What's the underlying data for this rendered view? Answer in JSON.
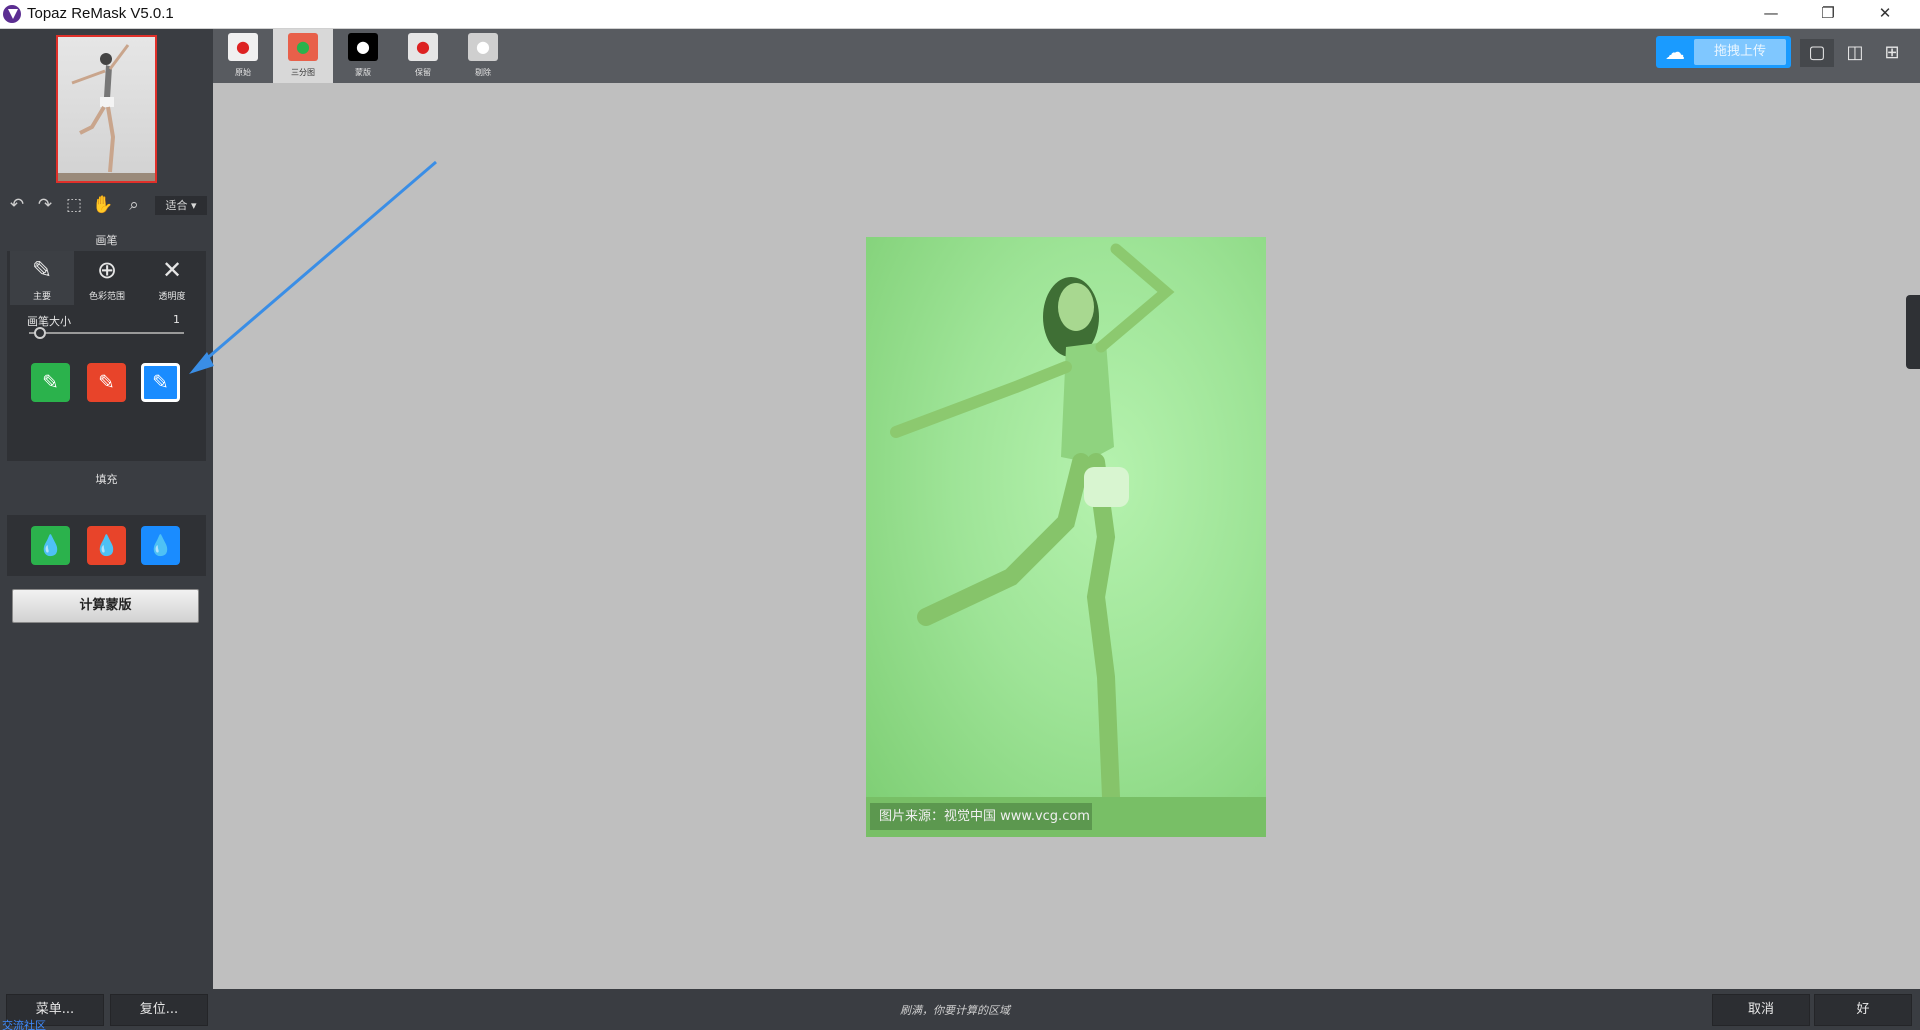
{
  "window": {
    "title": "Topaz ReMask V5.0.1",
    "minimize_glyph": "—",
    "restore_glyph": "❐",
    "close_glyph": "✕"
  },
  "left_panel": {
    "zoom_select": "适合 ▾",
    "brush_section_title": "画笔",
    "brush_types": [
      {
        "label": "主要",
        "icon": "brush-icon"
      },
      {
        "label": "色彩范围",
        "icon": "color-range-brush-icon"
      },
      {
        "label": "透明度",
        "icon": "transparency-brush-icon"
      }
    ],
    "brush_size_label": "画笔大小",
    "brush_size_value": "1",
    "brush_size_fraction": 0.03,
    "fill_section_title": "填充",
    "compute_button": "计算蒙版"
  },
  "toolbar": {
    "view_tabs": [
      {
        "label": "原始",
        "icon": "apple-icon"
      },
      {
        "label": "三分图",
        "icon": "trimap-icon"
      },
      {
        "label": "蒙版",
        "icon": "mask-icon"
      },
      {
        "label": "保留",
        "icon": "keep-icon"
      },
      {
        "label": "剔除",
        "icon": "cutout-icon"
      }
    ],
    "active_tab_index": 1,
    "upload_label": "拖拽上传"
  },
  "canvas": {
    "watermark": "图片来源：视觉中国 www.vcg.com"
  },
  "statusbar": {
    "menu_button": "菜单...",
    "reset_button": "复位...",
    "hint": "刷满，你要计算的区域",
    "cancel_button": "取消",
    "ok_button": "好",
    "community_link": "交流社区"
  },
  "colors": {
    "keep": "#2bb24c",
    "drop": "#e8442a",
    "compute": "#1a8cff",
    "annotation_arrow": "#3a8ee6"
  }
}
